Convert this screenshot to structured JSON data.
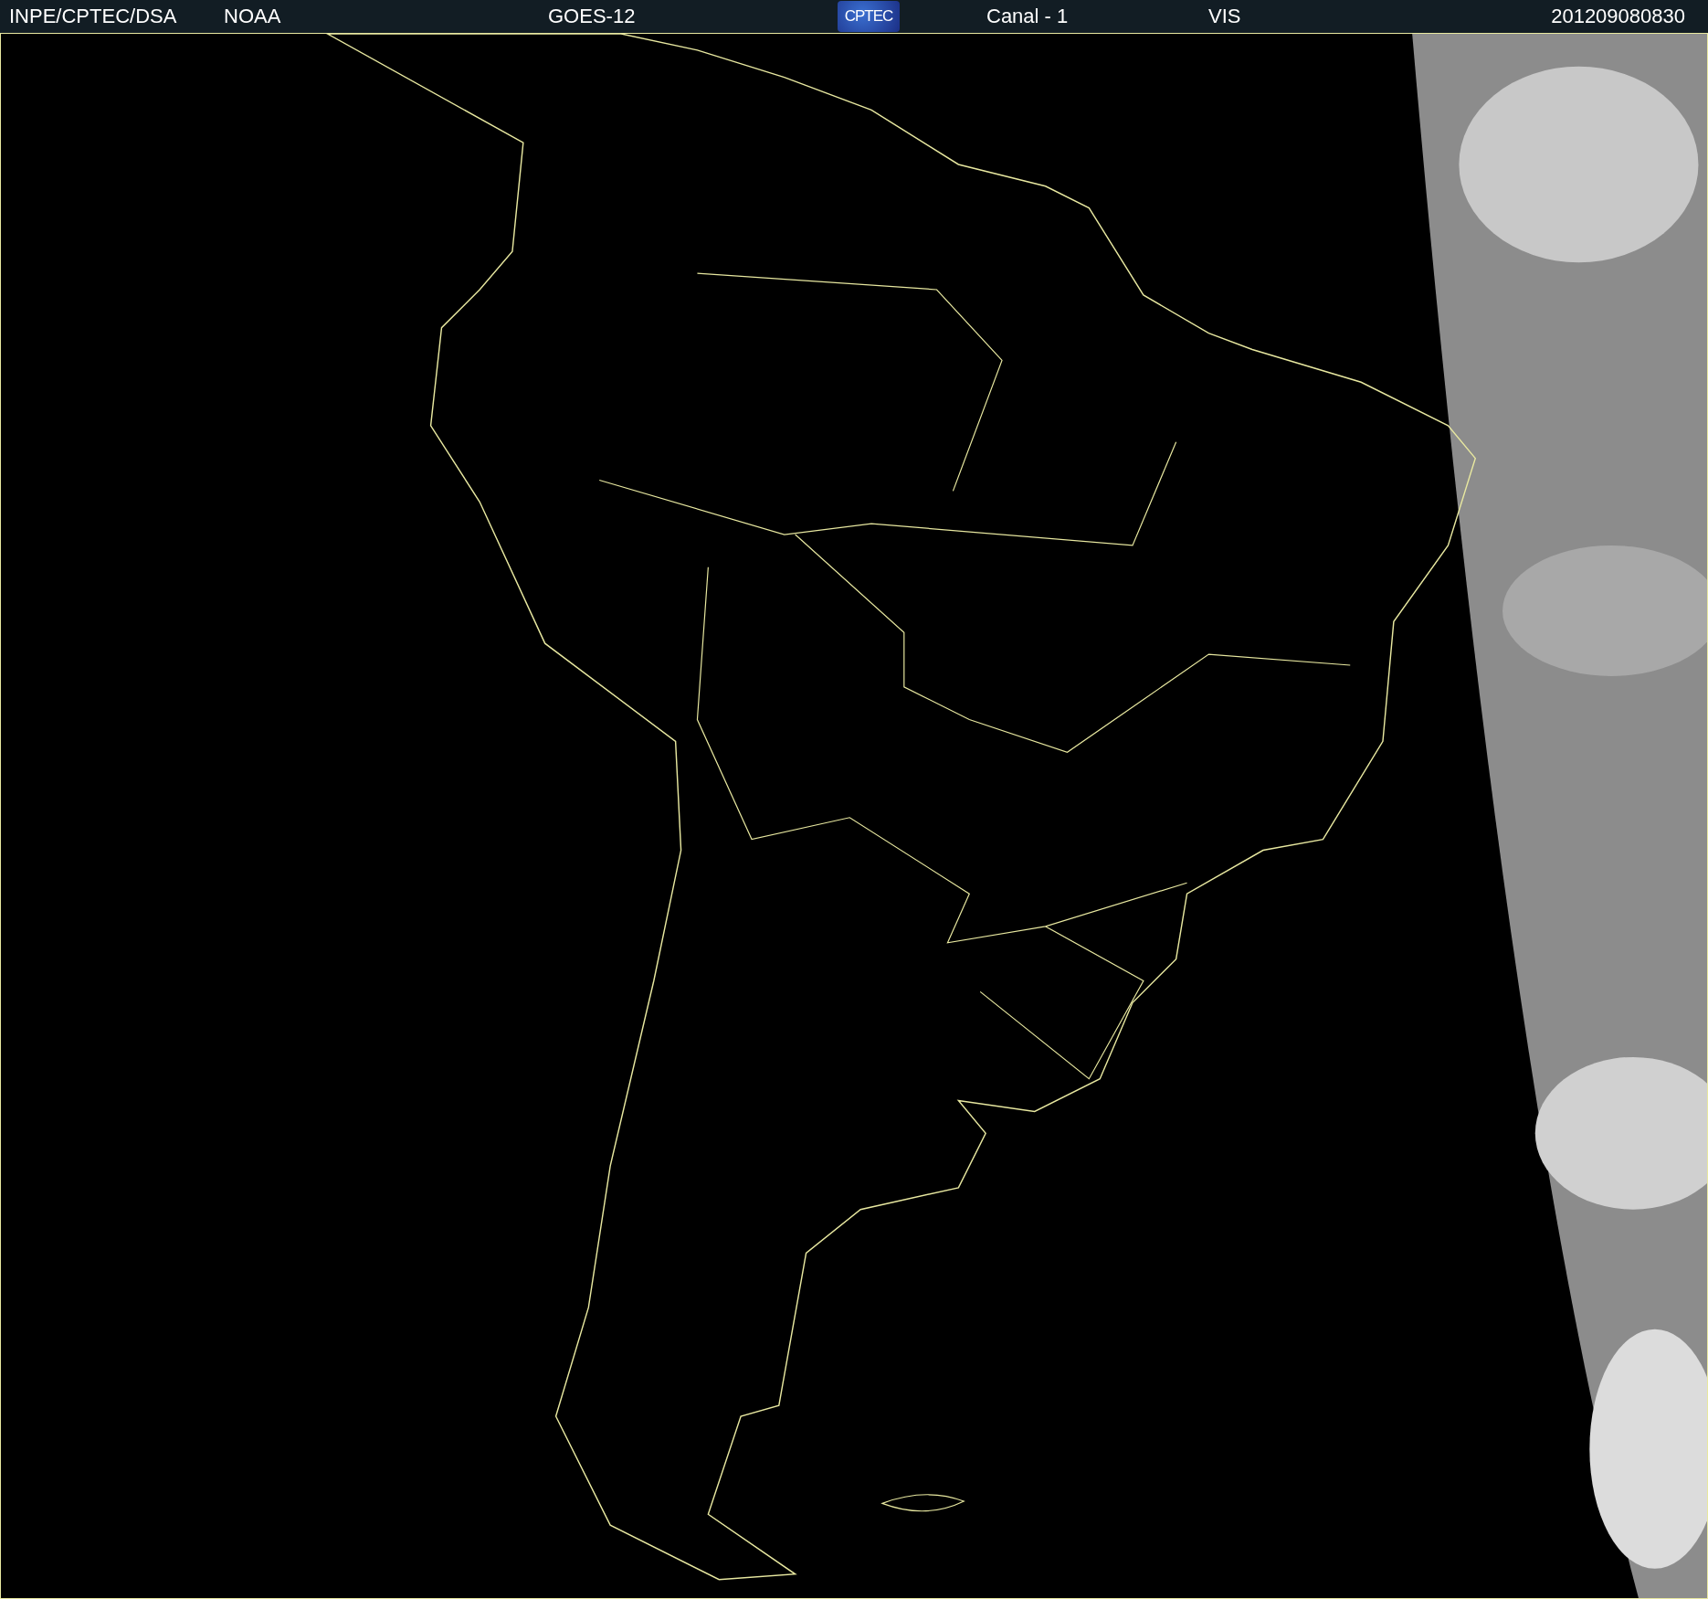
{
  "header": {
    "items": [
      {
        "kind": "text",
        "label": "INPE/CPTEC/DSA"
      },
      {
        "kind": "text",
        "label": "NOAA"
      },
      {
        "kind": "text",
        "label": "GOES-12"
      },
      {
        "kind": "logo",
        "label": "CPTEC"
      },
      {
        "kind": "text",
        "label": "Canal - 1"
      },
      {
        "kind": "text",
        "label": "VIS"
      },
      {
        "kind": "text",
        "label": "201209080830"
      }
    ]
  }
}
